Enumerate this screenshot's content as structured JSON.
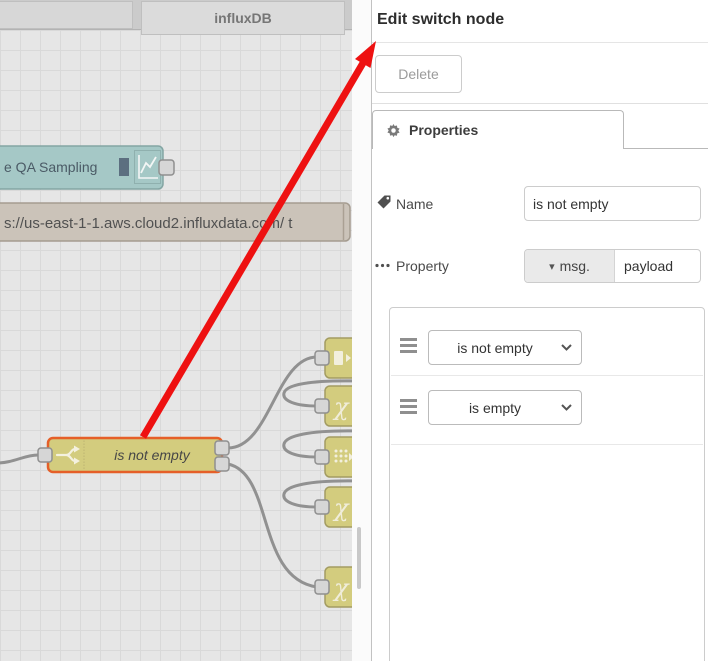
{
  "workspace": {
    "tabs": [
      {
        "label": ""
      },
      {
        "label": "influxDB"
      }
    ],
    "nodes": {
      "qa_sampling": {
        "label": "e QA Sampling",
        "icon": "chart-icon"
      },
      "influx_url": {
        "label": "s://us-east-1-1.aws.cloud2.influxdata.com/ t"
      },
      "switch": {
        "label": "is not empty",
        "icon": "switch-icon",
        "selected": true
      },
      "clipped": [
        {
          "icon": "template-icon"
        },
        {
          "icon": "chi-icon"
        },
        {
          "icon": "grid-icon"
        },
        {
          "icon": "chi-icon"
        },
        {
          "icon": "chi-icon"
        }
      ]
    }
  },
  "panel": {
    "title": "Edit switch node",
    "delete_button": "Delete",
    "properties_tab": "Properties",
    "name_label": "Name",
    "name_value": "is not empty",
    "property_label": "Property",
    "property_type": "msg.",
    "property_value": "payload",
    "rules": [
      {
        "operator": "is not empty"
      },
      {
        "operator": "is empty"
      }
    ]
  },
  "colors": {
    "node_yellow": "#d3cc7e",
    "node_teal": "#a5c8c6",
    "node_tan": "#cbc3b9",
    "selected_border": "#e55f28",
    "wire": "#919191",
    "arrow_red": "#ee1111",
    "canvas_bg": "#e6e6e6"
  }
}
